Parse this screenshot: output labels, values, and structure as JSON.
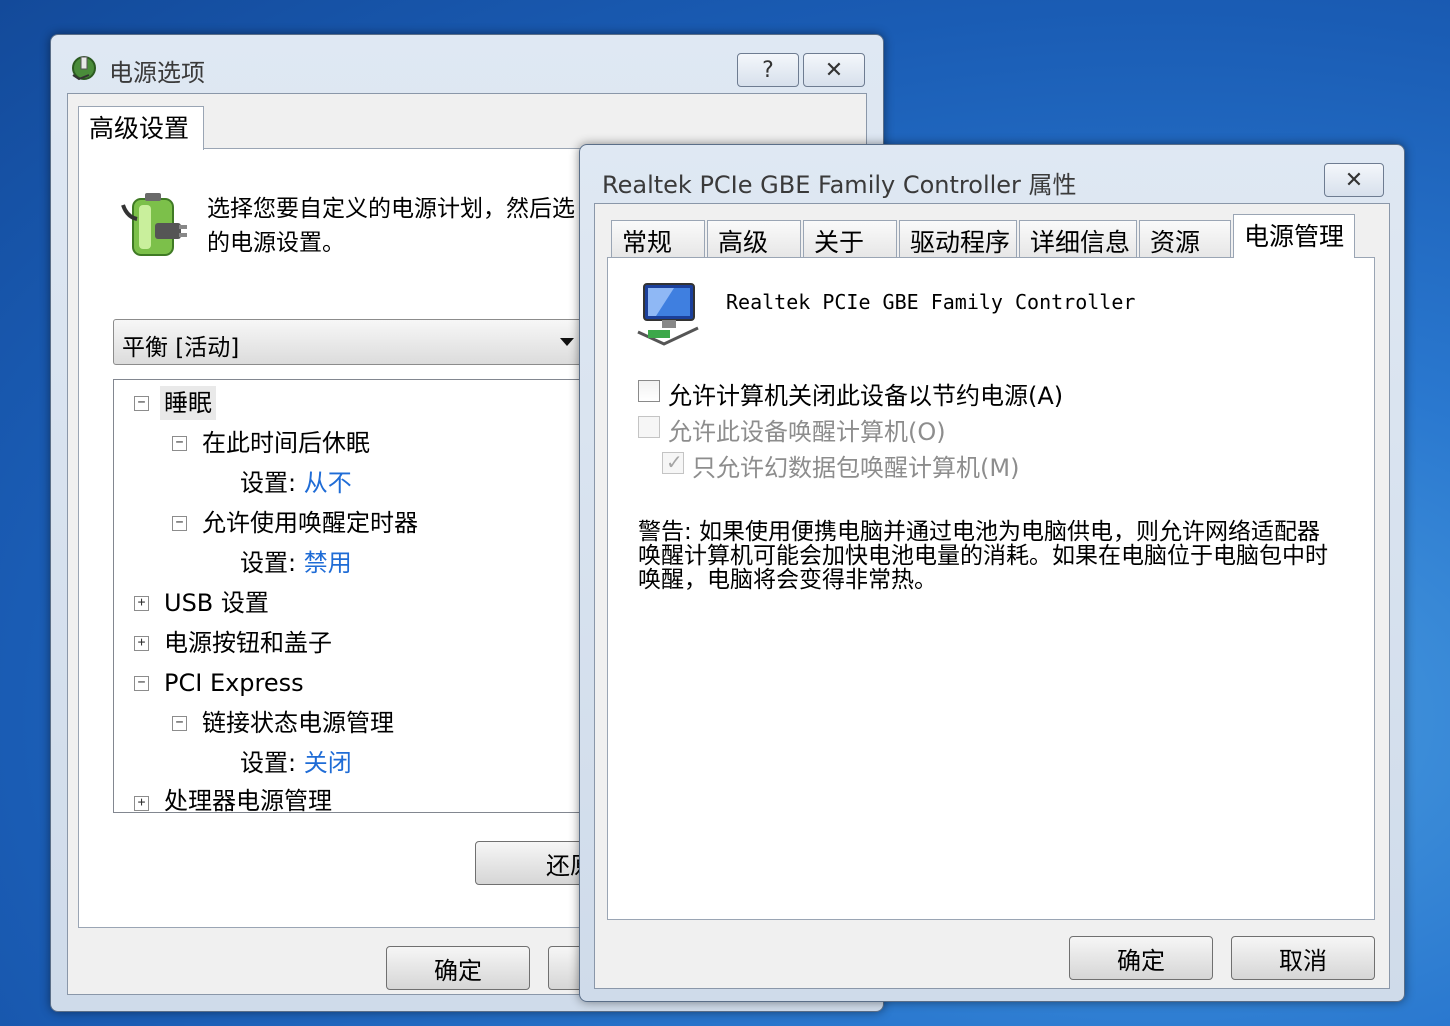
{
  "power_window": {
    "title": "电源选项",
    "help_button": "?",
    "close_button": "✕",
    "tab": "高级设置",
    "description_line1": "选择您要自定义的电源计划，然后选",
    "description_line2": "的电源设置。",
    "plan_selected": "平衡 [活动]",
    "tree": {
      "sleep": "睡眠",
      "hibernate_after": "在此时间后休眠",
      "setting_label": "设置:",
      "hibernate_value": "从不",
      "wake_timers": "允许使用唤醒定时器",
      "wake_timers_value": "禁用",
      "usb": "USB 设置",
      "power_buttons": "电源按钮和盖子",
      "pci_express": "PCI Express",
      "link_state": "链接状态电源管理",
      "link_state_value": "关闭",
      "processor": "处理器电源管理"
    },
    "restore_button": "还原",
    "ok_button": "确定"
  },
  "nic_window": {
    "title": "Realtek PCIe GBE Family Controller 属性",
    "close_button": "✕",
    "tabs": [
      "常规",
      "高级",
      "关于",
      "驱动程序",
      "详细信息",
      "资源",
      "电源管理"
    ],
    "device_name": "Realtek PCIe GBE Family Controller",
    "option1": "允许计算机关闭此设备以节约电源(A)",
    "option2": "允许此设备唤醒计算机(O)",
    "option3": "只允许幻数据包唤醒计算机(M)",
    "warning": "警告: 如果使用便携电脑并通过电池为电脑供电，则允许网络适配器唤醒计算机可能会加快电池电量的消耗。如果在电脑位于电脑包中时唤醒，电脑将会变得非常热。",
    "ok_button": "确定",
    "cancel_button": "取消"
  }
}
